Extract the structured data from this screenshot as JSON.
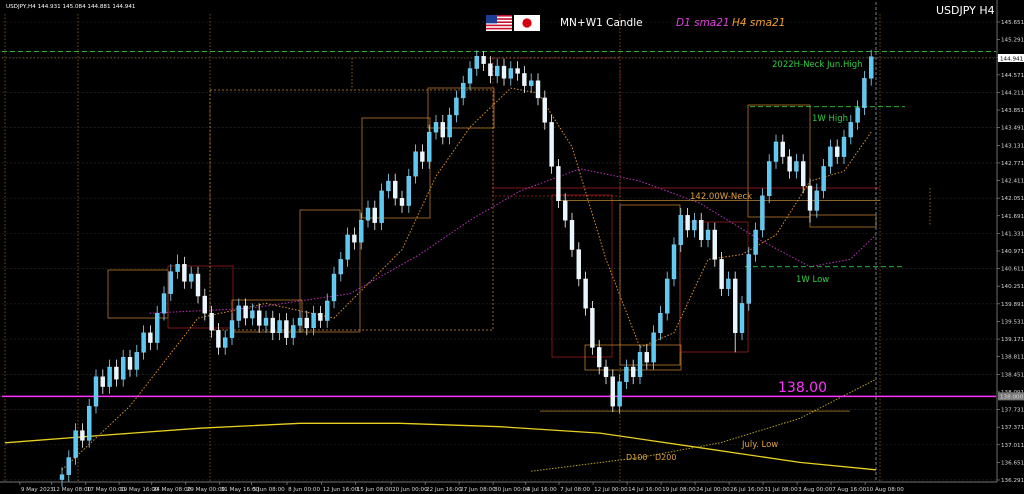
{
  "header": {
    "symbol_line": "USDJPY,H4  144.931 145.084 144.881 144.941",
    "title_right": "USDJPY H4",
    "legend_candle": "MN+W1 Candle",
    "legend_d1": "D1 sma21",
    "legend_h4": "H4 sma21",
    "current_price": "144.941",
    "colors": {
      "d1": "#e040e0",
      "h4": "#f0a030",
      "level_green": "#2ecc40",
      "level_magenta": "#ff33ff",
      "orange": "#e0a040"
    }
  },
  "chart_data": {
    "type": "candlestick",
    "title": "USDJPY H4",
    "xlabel": "",
    "ylabel": "",
    "ylim": [
      136.1,
      146.05
    ],
    "grid": true,
    "y_ticks": [
      145.651,
      145.291,
      144.931,
      144.571,
      144.211,
      143.851,
      143.491,
      143.131,
      142.771,
      142.411,
      142.051,
      141.691,
      141.331,
      140.971,
      140.611,
      140.251,
      139.891,
      139.531,
      139.171,
      138.811,
      138.451,
      138.091,
      137.731,
      137.371,
      137.011,
      136.651,
      136.291
    ],
    "x_ticks": [
      {
        "at": -6.2,
        "label": "9 May 2023"
      },
      {
        "at": -1.5,
        "label": "12 May 08:00"
      },
      {
        "at": 3.5,
        "label": "17 May 00:00"
      },
      {
        "at": 8.4,
        "label": "19 May 16:00"
      },
      {
        "at": 13.2,
        "label": "24 May 08:00"
      },
      {
        "at": 18.2,
        "label": "29 May 00:00"
      },
      {
        "at": 23.2,
        "label": "31 May 16:00"
      },
      {
        "at": 27.9,
        "label": "5 Jun 08:00"
      },
      {
        "at": 33.1,
        "label": "8 Jun 00:00"
      },
      {
        "at": 38.2,
        "label": "12 Jun 16:00"
      },
      {
        "at": 43.2,
        "label": "15 Jun 08:00"
      },
      {
        "at": 48.4,
        "label": "20 Jun 00:00"
      },
      {
        "at": 53.4,
        "label": "22 Jun 16:00"
      },
      {
        "at": 58.4,
        "label": "27 Jun 08:00"
      },
      {
        "at": 63.4,
        "label": "30 Jun 00:00"
      },
      {
        "at": 68.2,
        "label": "4 Jul 16:00"
      },
      {
        "at": 73.1,
        "label": "7 Jul 08:00"
      },
      {
        "at": 78.1,
        "label": "12 Jul 00:00"
      },
      {
        "at": 83.1,
        "label": "14 Jul 16:00"
      },
      {
        "at": 88.1,
        "label": "19 Jul 08:00"
      },
      {
        "at": 93.1,
        "label": "24 Jul 00:00"
      },
      {
        "at": 98.1,
        "label": "26 Jul 16:00"
      },
      {
        "at": 103.1,
        "label": "31 Jul 08:00"
      },
      {
        "at": 108.1,
        "label": "3 Aug 00:00"
      },
      {
        "at": 113.1,
        "label": "7 Aug 16:00"
      },
      {
        "at": 118.1,
        "label": "10 Aug 08:00"
      }
    ],
    "ohlc": [
      [
        136.3,
        136.55,
        136.15,
        136.4
      ],
      [
        136.4,
        136.9,
        136.25,
        136.75
      ],
      [
        136.75,
        137.45,
        136.6,
        137.3
      ],
      [
        137.3,
        137.45,
        136.95,
        137.1
      ],
      [
        137.1,
        137.95,
        136.95,
        137.8
      ],
      [
        137.8,
        138.55,
        137.65,
        138.4
      ],
      [
        138.4,
        138.55,
        138.05,
        138.2
      ],
      [
        138.2,
        138.75,
        138.05,
        138.6
      ],
      [
        138.6,
        138.75,
        138.2,
        138.35
      ],
      [
        138.35,
        138.95,
        138.2,
        138.8
      ],
      [
        138.8,
        138.95,
        138.4,
        138.55
      ],
      [
        138.55,
        139.05,
        138.4,
        138.9
      ],
      [
        138.9,
        139.45,
        138.75,
        139.3
      ],
      [
        139.3,
        139.45,
        138.95,
        139.1
      ],
      [
        139.1,
        139.85,
        138.95,
        139.7
      ],
      [
        139.7,
        140.25,
        139.55,
        140.1
      ],
      [
        140.1,
        140.7,
        139.95,
        140.55
      ],
      [
        140.55,
        140.9,
        140.4,
        140.7
      ],
      [
        140.7,
        140.85,
        140.2,
        140.35
      ],
      [
        140.35,
        140.65,
        140.2,
        140.5
      ],
      [
        140.5,
        140.65,
        139.9,
        140.05
      ],
      [
        140.05,
        140.2,
        139.55,
        139.7
      ],
      [
        139.7,
        139.85,
        139.2,
        139.35
      ],
      [
        139.35,
        139.5,
        138.85,
        139.0
      ],
      [
        139.0,
        139.35,
        138.85,
        139.2
      ],
      [
        139.2,
        139.7,
        139.05,
        139.55
      ],
      [
        139.55,
        140.0,
        139.4,
        139.85
      ],
      [
        139.85,
        140.0,
        139.45,
        139.6
      ],
      [
        139.6,
        139.9,
        139.45,
        139.75
      ],
      [
        139.75,
        139.9,
        139.3,
        139.45
      ],
      [
        139.45,
        139.75,
        139.3,
        139.6
      ],
      [
        139.6,
        139.75,
        139.15,
        139.3
      ],
      [
        139.3,
        139.7,
        139.15,
        139.55
      ],
      [
        139.55,
        139.7,
        139.05,
        139.2
      ],
      [
        139.2,
        139.6,
        139.05,
        139.45
      ],
      [
        139.45,
        139.75,
        139.3,
        139.6
      ],
      [
        139.6,
        139.75,
        139.25,
        139.4
      ],
      [
        139.4,
        139.85,
        139.25,
        139.7
      ],
      [
        139.7,
        139.85,
        139.4,
        139.55
      ],
      [
        139.55,
        140.1,
        139.4,
        139.95
      ],
      [
        139.95,
        140.65,
        139.8,
        140.5
      ],
      [
        140.5,
        140.95,
        140.35,
        140.8
      ],
      [
        140.8,
        141.45,
        140.65,
        141.3
      ],
      [
        141.3,
        141.45,
        141.0,
        141.15
      ],
      [
        141.15,
        141.75,
        141.0,
        141.6
      ],
      [
        141.6,
        142.0,
        141.45,
        141.85
      ],
      [
        141.85,
        142.0,
        141.4,
        141.55
      ],
      [
        141.55,
        142.35,
        141.4,
        142.2
      ],
      [
        142.2,
        142.55,
        142.05,
        142.4
      ],
      [
        142.4,
        142.55,
        141.9,
        142.05
      ],
      [
        142.05,
        142.2,
        141.75,
        141.9
      ],
      [
        141.9,
        142.65,
        141.75,
        142.5
      ],
      [
        142.5,
        143.15,
        142.35,
        143.0
      ],
      [
        143.0,
        143.15,
        142.65,
        142.8
      ],
      [
        142.8,
        143.55,
        142.65,
        143.4
      ],
      [
        143.4,
        143.75,
        143.25,
        143.6
      ],
      [
        143.6,
        143.75,
        143.15,
        143.3
      ],
      [
        143.3,
        143.9,
        143.15,
        143.75
      ],
      [
        143.75,
        144.25,
        143.6,
        144.1
      ],
      [
        144.1,
        144.55,
        143.95,
        144.4
      ],
      [
        144.4,
        144.85,
        144.25,
        144.7
      ],
      [
        144.7,
        145.07,
        144.55,
        144.95
      ],
      [
        144.95,
        145.05,
        144.65,
        144.8
      ],
      [
        144.8,
        144.95,
        144.4,
        144.55
      ],
      [
        144.55,
        144.9,
        144.4,
        144.75
      ],
      [
        144.75,
        144.9,
        144.35,
        144.5
      ],
      [
        144.5,
        144.85,
        144.35,
        144.7
      ],
      [
        144.7,
        144.85,
        144.45,
        144.6
      ],
      [
        144.6,
        144.75,
        144.2,
        144.35
      ],
      [
        144.35,
        144.6,
        144.2,
        144.45
      ],
      [
        144.45,
        144.6,
        143.95,
        144.1
      ],
      [
        144.1,
        144.25,
        143.45,
        143.6
      ],
      [
        143.6,
        143.75,
        142.55,
        142.7
      ],
      [
        142.7,
        142.85,
        141.85,
        142.0
      ],
      [
        142.0,
        142.15,
        141.45,
        141.6
      ],
      [
        141.6,
        141.75,
        140.85,
        141.0
      ],
      [
        141.0,
        141.15,
        140.25,
        140.4
      ],
      [
        140.4,
        140.55,
        139.65,
        139.8
      ],
      [
        139.8,
        139.95,
        138.85,
        139.0
      ],
      [
        139.0,
        139.15,
        138.45,
        138.6
      ],
      [
        138.6,
        138.75,
        138.25,
        138.4
      ],
      [
        138.4,
        138.55,
        137.68,
        137.8
      ],
      [
        137.8,
        138.45,
        137.65,
        138.3
      ],
      [
        138.3,
        138.75,
        138.15,
        138.6
      ],
      [
        138.6,
        138.75,
        138.25,
        138.4
      ],
      [
        138.4,
        139.05,
        138.25,
        138.9
      ],
      [
        138.9,
        139.05,
        138.55,
        138.7
      ],
      [
        138.7,
        139.45,
        138.55,
        139.3
      ],
      [
        139.3,
        139.85,
        139.15,
        139.7
      ],
      [
        139.7,
        140.55,
        139.55,
        140.4
      ],
      [
        140.4,
        141.25,
        140.25,
        141.1
      ],
      [
        141.1,
        141.85,
        140.95,
        141.7
      ],
      [
        141.7,
        141.85,
        141.25,
        141.4
      ],
      [
        141.4,
        141.75,
        141.25,
        141.6
      ],
      [
        141.6,
        141.75,
        141.05,
        141.2
      ],
      [
        141.2,
        141.55,
        141.05,
        141.4
      ],
      [
        141.4,
        141.55,
        140.65,
        140.8
      ],
      [
        140.8,
        140.95,
        140.05,
        140.2
      ],
      [
        140.2,
        140.55,
        140.05,
        140.4
      ],
      [
        140.4,
        140.55,
        138.9,
        139.3
      ],
      [
        139.3,
        140.05,
        139.15,
        139.9
      ],
      [
        139.9,
        141.05,
        139.75,
        140.9
      ],
      [
        140.9,
        141.55,
        140.75,
        141.4
      ],
      [
        141.4,
        142.25,
        141.25,
        142.1
      ],
      [
        142.1,
        142.95,
        141.95,
        142.8
      ],
      [
        142.8,
        143.35,
        142.65,
        143.2
      ],
      [
        143.2,
        143.35,
        142.75,
        142.9
      ],
      [
        142.9,
        143.05,
        142.45,
        142.6
      ],
      [
        142.6,
        142.95,
        142.45,
        142.8
      ],
      [
        142.8,
        142.95,
        142.15,
        142.3
      ],
      [
        142.3,
        142.45,
        141.55,
        141.8
      ],
      [
        141.8,
        142.35,
        141.65,
        142.2
      ],
      [
        142.2,
        142.85,
        142.05,
        142.7
      ],
      [
        142.7,
        143.25,
        142.55,
        143.1
      ],
      [
        143.1,
        143.25,
        142.75,
        142.9
      ],
      [
        142.9,
        143.45,
        142.75,
        143.3
      ],
      [
        143.3,
        143.75,
        143.15,
        143.6
      ],
      [
        143.6,
        144.05,
        143.45,
        143.9
      ],
      [
        143.9,
        144.65,
        143.75,
        144.5
      ],
      [
        144.5,
        145.08,
        144.35,
        144.94
      ]
    ],
    "overlays": {
      "ma_yellow_solid": [
        [
          -8.4,
          137.05
        ],
        [
          5.6,
          137.2
        ],
        [
          20.3,
          137.35
        ],
        [
          35,
          137.45
        ],
        [
          49.7,
          137.45
        ],
        [
          64.4,
          137.38
        ],
        [
          79.1,
          137.25
        ],
        [
          93.8,
          136.95
        ],
        [
          108.5,
          136.65
        ],
        [
          119.7,
          136.5
        ]
      ],
      "ma_yellow_dotted": [
        [
          69,
          136.47
        ],
        [
          85,
          136.75
        ],
        [
          96.8,
          137.05
        ],
        [
          108.5,
          137.55
        ],
        [
          119.7,
          138.35
        ]
      ],
      "d1_sma21": [
        [
          12.9,
          139.7
        ],
        [
          27.6,
          139.8
        ],
        [
          42.4,
          140.1
        ],
        [
          52.6,
          140.9
        ],
        [
          60,
          141.6
        ],
        [
          67.4,
          142.2
        ],
        [
          76.2,
          142.65
        ],
        [
          85,
          142.4
        ],
        [
          93.8,
          141.95
        ],
        [
          102.6,
          141.2
        ],
        [
          110,
          140.65
        ],
        [
          115.9,
          140.8
        ],
        [
          119.7,
          141.3
        ]
      ],
      "h4_sma21": [
        [
          0,
          136.5
        ],
        [
          10,
          137.8
        ],
        [
          20,
          139.6
        ],
        [
          30,
          139.9
        ],
        [
          40,
          139.6
        ],
        [
          50,
          141.0
        ],
        [
          55,
          142.5
        ],
        [
          60,
          143.5
        ],
        [
          66,
          144.3
        ],
        [
          70,
          144.2
        ],
        [
          75,
          143.1
        ],
        [
          80,
          140.8
        ],
        [
          85,
          139.0
        ],
        [
          90,
          139.3
        ],
        [
          95,
          140.8
        ],
        [
          100,
          140.9
        ],
        [
          105,
          141.3
        ],
        [
          110,
          142.4
        ],
        [
          115,
          142.6
        ],
        [
          119,
          143.4
        ]
      ]
    },
    "levels": [
      {
        "id": "jun-high",
        "price": 145.05,
        "label": "2022H-Neck  Jun.High",
        "color": "#2ecc40"
      },
      {
        "id": "w1-high",
        "price": 143.92,
        "label": "1W High",
        "color": "#2ecc40"
      },
      {
        "id": "w-neck",
        "price": 142.0,
        "label": "142.00W-Neck",
        "color": "#e0a040"
      },
      {
        "id": "w1-low",
        "price": 140.65,
        "label": "1W Low",
        "color": "#2ecc40"
      },
      {
        "id": "round-138",
        "price": 138.0,
        "label": "138.00",
        "color": "#ff33ff"
      },
      {
        "id": "july-low",
        "price": 137.7,
        "label": "July. Low",
        "color": "#e0a040"
      }
    ],
    "ma_labels": [
      "D100",
      "D200"
    ],
    "axis_boxes": [
      {
        "price": 138.0,
        "label": "138.000"
      }
    ]
  }
}
